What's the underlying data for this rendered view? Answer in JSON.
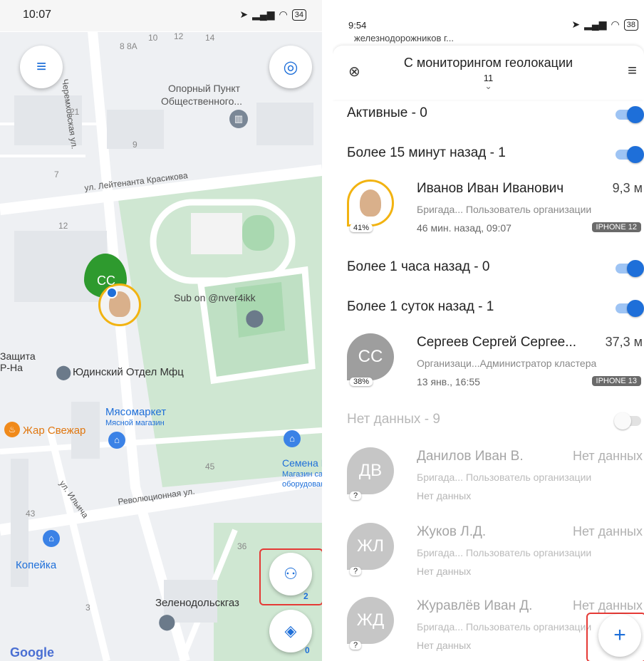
{
  "left": {
    "status": {
      "time": "10:07",
      "battery": "34"
    },
    "map_labels": {
      "street1": "ул. Лейтенанта Красикова",
      "street2": "Черемховская ул.",
      "street3": "ул. Ильича",
      "street4": "Революционная ул.",
      "poi1": "Опорный Пункт",
      "poi1b": "Общественного...",
      "poi2": "Sub on @nver4ikk",
      "poi3": "Юдинский Отдел Мфц",
      "poi4": "Мясомаркет",
      "poi4b": "Мясной магазин",
      "poi5": "Жар Свежар",
      "poi6": "Копейка",
      "poi7": "Зеленодольскгаз",
      "poi8": "Семена L",
      "poi8b": "Магазин са",
      "poi8c": "оборудован",
      "poi9": "Защита",
      "poi9b": "Р-На",
      "n1": "10",
      "n2": "12",
      "n3": "14",
      "n4": "8 8А",
      "n5": "21",
      "n6": "9",
      "n7": "7",
      "n8": "12",
      "n9": "45",
      "n10": "43",
      "n11": "36",
      "n12": "3"
    },
    "marker_initials": "СС",
    "people_count": "2",
    "layers_count": "0",
    "google": "Google"
  },
  "right": {
    "status": {
      "time": "9:54",
      "battery": "38"
    },
    "address": "железнодорожников г...",
    "sheet": {
      "title": "С мониторингом геолокации",
      "count": "11"
    },
    "sections": [
      {
        "label": "Активные - 0",
        "on": true
      },
      {
        "label": "Более 15 минут назад - 1",
        "on": true
      },
      {
        "label": "Более 1 часа назад - 0",
        "on": true
      },
      {
        "label": "Более 1 суток назад - 1",
        "on": true
      },
      {
        "label": "Нет данных - 9",
        "on": false
      }
    ],
    "users": [
      {
        "name": "Иванов Иван Иванович",
        "dist": "9,3 м",
        "role": "Бригада...  Пользователь организации",
        "time": "46 мин. назад, 09:07",
        "device": "IPHONE 12",
        "battery": "41%",
        "initials": ""
      },
      {
        "name": "Сергеев Сергей Сергее...",
        "dist": "37,3 м",
        "role": "Организаци...Администратор кластера",
        "time": "13 янв., 16:55",
        "device": "IPHONE 13",
        "battery": "38%",
        "initials": "СС"
      },
      {
        "name": "Данилов Иван В.",
        "dist": "Нет данных",
        "role": "Бригада...  Пользователь организации",
        "time": "Нет данных",
        "battery": "?",
        "initials": "ДВ"
      },
      {
        "name": "Жуков Л.Д.",
        "dist": "Нет данных",
        "role": "Бригада...  Пользователь организации",
        "time": "Нет данных",
        "battery": "?",
        "initials": "ЖЛ"
      },
      {
        "name": "Журавлёв Иван Д.",
        "dist": "Нет данных",
        "role": "Бригада...  Пользователь организации",
        "time": "Нет данных",
        "battery": "?",
        "initials": "ЖД"
      }
    ],
    "add_label": "+"
  },
  "colors": {
    "accent": "#1e6fd9",
    "highlight": "#e53935",
    "marker_green": "#2e9a2e",
    "ring": "#f2b311"
  }
}
